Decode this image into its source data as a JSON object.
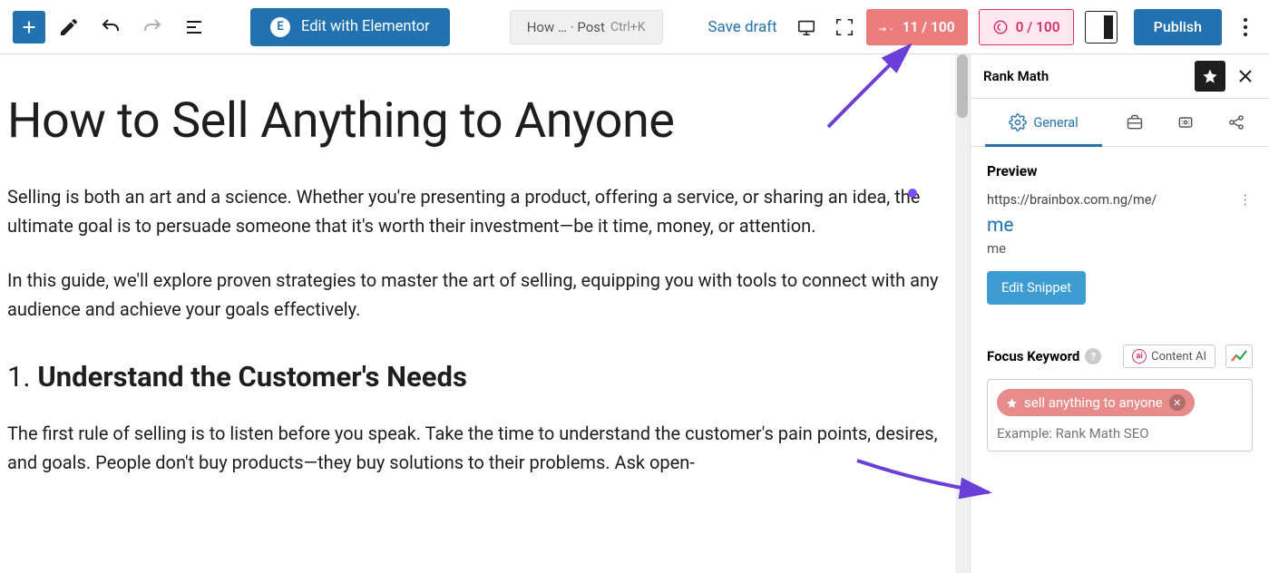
{
  "toolbar": {
    "elementor_label": "Edit with Elementor",
    "command_label": "How … · Post",
    "command_shortcut": "Ctrl+K",
    "save_draft": "Save draft",
    "seo_score": "11 / 100",
    "ai_score": "0 / 100",
    "publish": "Publish"
  },
  "editor": {
    "title": "How to Sell Anything to Anyone",
    "para1": "Selling is both an art and a science. Whether you're presenting a product, offering a service, or sharing an idea, the ultimate goal is to persuade someone that it's worth their investment—be it time, money, or attention.",
    "para2": "In this guide, we'll explore proven strategies to master the art of selling, equipping you with tools to connect with any audience and achieve your goals effectively.",
    "h2_num": "1.",
    "h2_text": "Understand the Customer's Needs",
    "para3": "The first rule of selling is to listen before you speak. Take the time to understand the customer's pain points, desires, and goals. People don't buy products—they buy solutions to their problems. Ask open-"
  },
  "sidebar": {
    "plugin_name": "Rank Math",
    "tab_general": "General",
    "preview_label": "Preview",
    "preview_url": "https://brainbox.com.ng/me/",
    "preview_title": "me",
    "preview_desc": "me",
    "edit_snippet": "Edit Snippet",
    "focus_keyword_label": "Focus Keyword",
    "content_ai": "Content AI",
    "keyword_pill": "sell anything to anyone",
    "keyword_placeholder": "Example: Rank Math SEO"
  }
}
